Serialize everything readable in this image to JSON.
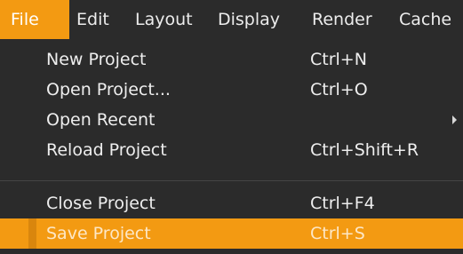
{
  "menubar": {
    "items": [
      {
        "label": "File"
      },
      {
        "label": "Edit"
      },
      {
        "label": "Layout"
      },
      {
        "label": "Display"
      },
      {
        "label": "Render"
      },
      {
        "label": "Cache"
      }
    ]
  },
  "file_menu": {
    "items": [
      {
        "label": "New Project",
        "shortcut": "Ctrl+N"
      },
      {
        "label": "Open Project...",
        "shortcut": "Ctrl+O"
      },
      {
        "label": "Open Recent",
        "shortcut": ""
      },
      {
        "label": "Reload Project",
        "shortcut": "Ctrl+Shift+R"
      },
      {
        "label": "Close Project",
        "shortcut": "Ctrl+F4"
      },
      {
        "label": "Save Project",
        "shortcut": "Ctrl+S"
      }
    ]
  },
  "colors": {
    "accent": "#f39a12",
    "menu_background": "#2b2b2b",
    "text": "#eeeeee"
  }
}
